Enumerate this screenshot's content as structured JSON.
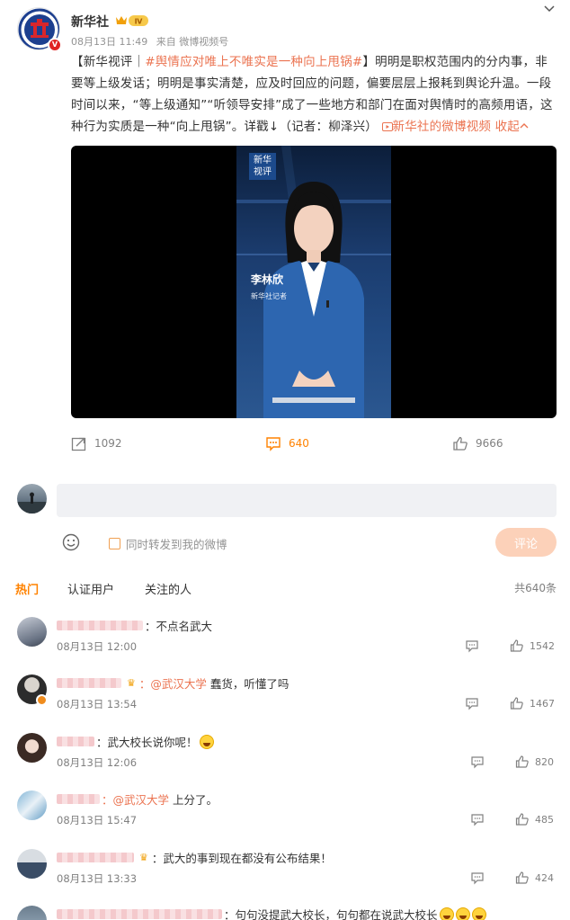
{
  "post": {
    "author": "新华社",
    "level_badge": "Ⅳ",
    "date": "08月13日 11:49",
    "source": "来自 微博视频号",
    "content": {
      "prefix": "【新华视评｜",
      "topic": "#舆情应对唯上不唯实是一种向上甩锅#",
      "body": "】明明是职权范围内的分内事，非要等上级发话；明明是事实清楚，应及时回应的问题，偏要层层上报耗到舆论升温。一段时间以来，“等上级通知”“听领导安排”成了一些地方和部门在面对舆情时的高频用语，这种行为实质是一种“向上甩锅”。详戳↓（记者：柳泽兴）",
      "video_link": "新华社的微博视频",
      "collapse": "收起"
    },
    "video": {
      "logo_text": "新华\n视评",
      "person_name": "李林欣",
      "person_role": "新华社记者"
    },
    "actions": {
      "forward": "1092",
      "comments": "640",
      "likes": "9666"
    }
  },
  "compose": {
    "placeholder": "",
    "forward_label": "同时转发到我的微博",
    "submit_label": "评论"
  },
  "tabs": {
    "hot": "热门",
    "verified": "认证用户",
    "following": "关注的人",
    "total": "共640条"
  },
  "comments": [
    {
      "text": "：不点名武大",
      "at": "",
      "time": "08月13日 12:00",
      "likes": "1542"
    },
    {
      "text": "蠢货，听懂了吗",
      "at": "：@武汉大学",
      "time": "08月13日 13:54",
      "likes": "1467"
    },
    {
      "text": "：武大校长说你呢！",
      "at": "",
      "time": "08月13日 12:06",
      "likes": "820"
    },
    {
      "text": "上分了。",
      "at": "：@武汉大学",
      "time": "08月13日 15:47",
      "likes": "485"
    },
    {
      "text": "：武大的事到现在都没有公布结果！",
      "at": "",
      "time": "08月13日 13:33",
      "likes": "424"
    },
    {
      "text": "：句句没提武大校长，句句都在说武大校长",
      "at": "",
      "time": "",
      "likes": ""
    }
  ],
  "colors": {
    "accent": "#eb7350",
    "tab_active": "#ff8200",
    "submit_bg": "#fcd1b9"
  }
}
